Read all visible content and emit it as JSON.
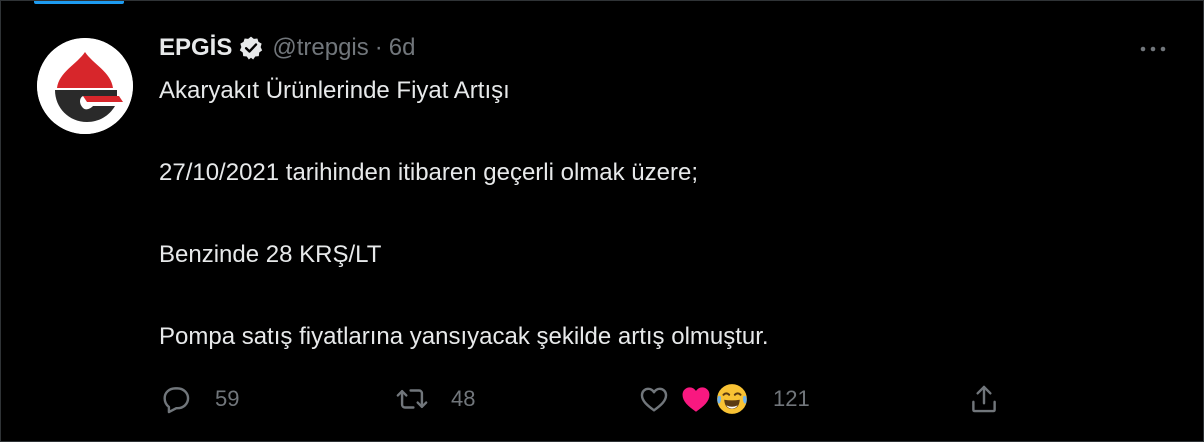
{
  "tweet": {
    "author_name": "EPGİS",
    "handle": "@trepgis",
    "separator": "·",
    "time": "6d",
    "text_lines": [
      "Akaryakıt Ürünlerinde Fiyat Artışı",
      "27/10/2021 tarihinden itibaren geçerli olmak üzere;",
      "Benzinde 28 KRŞ/LT",
      "Pompa satış fiyatlarına yansıyacak şekilde artış olmuştur."
    ],
    "reply_count": "59",
    "retweet_count": "48",
    "like_count": "121"
  },
  "icons": {
    "avatar": "epgis-logo",
    "verified": "verified-badge-icon",
    "more": "more-options-icon",
    "reply": "reply-icon",
    "retweet": "retweet-icon",
    "like": "heart-icon",
    "share": "share-icon"
  },
  "colors": {
    "background": "#000000",
    "text": "#e7e9ea",
    "muted": "#71767b",
    "accent": "#1d9bf0",
    "heart": "#f91880",
    "logo_red": "#d7262b"
  }
}
